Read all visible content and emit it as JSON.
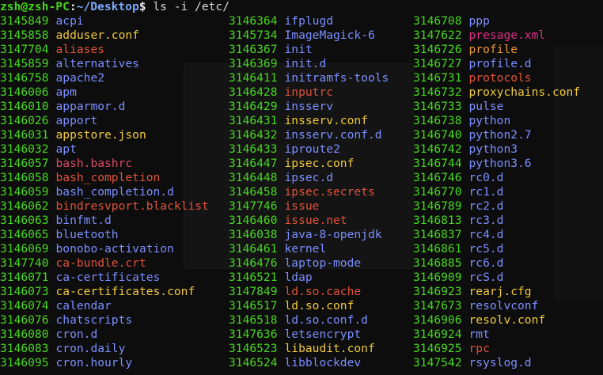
{
  "prompt": {
    "user_host": "zsh@zsh-PC",
    "separator": ":",
    "path": "~/Desktop",
    "symbol": "$",
    "command": " ls -i /etc/"
  },
  "colors": {
    "inode": "#47d820",
    "directory": "#7b8fff",
    "file": "#e8e8d0",
    "pink": "#e02f86",
    "red": "#e0533b",
    "rose": "#d94a64",
    "yellow": "#f0ca3c",
    "orange": "#e8963a",
    "background": "#0d0d0d"
  },
  "columns": [
    [
      {
        "inode": "3145849",
        "name": "acpi",
        "type": "dir"
      },
      {
        "inode": "3145858",
        "name": "adduser.conf",
        "type": "yellow"
      },
      {
        "inode": "3147704",
        "name": "aliases",
        "type": "red"
      },
      {
        "inode": "3145859",
        "name": "alternatives",
        "type": "dir"
      },
      {
        "inode": "3146758",
        "name": "apache2",
        "type": "dir"
      },
      {
        "inode": "3146006",
        "name": "apm",
        "type": "dir"
      },
      {
        "inode": "3146010",
        "name": "apparmor.d",
        "type": "dir"
      },
      {
        "inode": "3146026",
        "name": "apport",
        "type": "dir"
      },
      {
        "inode": "3146031",
        "name": "appstore.json",
        "type": "yellow"
      },
      {
        "inode": "3146032",
        "name": "apt",
        "type": "dir"
      },
      {
        "inode": "3146057",
        "name": "bash.bashrc",
        "type": "rose"
      },
      {
        "inode": "3146058",
        "name": "bash_completion",
        "type": "red"
      },
      {
        "inode": "3146059",
        "name": "bash_completion.d",
        "type": "dir"
      },
      {
        "inode": "3146062",
        "name": "bindresvport.blacklist",
        "type": "red"
      },
      {
        "inode": "3146063",
        "name": "binfmt.d",
        "type": "dir"
      },
      {
        "inode": "3146065",
        "name": "bluetooth",
        "type": "dir"
      },
      {
        "inode": "3146069",
        "name": "bonobo-activation",
        "type": "dir"
      },
      {
        "inode": "3147740",
        "name": "ca-bundle.crt",
        "type": "red"
      },
      {
        "inode": "3146071",
        "name": "ca-certificates",
        "type": "dir"
      },
      {
        "inode": "3146073",
        "name": "ca-certificates.conf",
        "type": "yellow"
      },
      {
        "inode": "3146074",
        "name": "calendar",
        "type": "dir"
      },
      {
        "inode": "3146076",
        "name": "chatscripts",
        "type": "dir"
      },
      {
        "inode": "3146080",
        "name": "cron.d",
        "type": "dir"
      },
      {
        "inode": "3146083",
        "name": "cron.daily",
        "type": "dir"
      },
      {
        "inode": "3146095",
        "name": "cron.hourly",
        "type": "dir"
      }
    ],
    [
      {
        "inode": "3146364",
        "name": "ifplugd",
        "type": "dir"
      },
      {
        "inode": "3145734",
        "name": "ImageMagick-6",
        "type": "dir"
      },
      {
        "inode": "3146367",
        "name": "init",
        "type": "dir"
      },
      {
        "inode": "3146369",
        "name": "init.d",
        "type": "dir"
      },
      {
        "inode": "3146411",
        "name": "initramfs-tools",
        "type": "dir"
      },
      {
        "inode": "3146428",
        "name": "inputrc",
        "type": "red"
      },
      {
        "inode": "3146429",
        "name": "insserv",
        "type": "dir"
      },
      {
        "inode": "3146431",
        "name": "insserv.conf",
        "type": "yellow"
      },
      {
        "inode": "3146432",
        "name": "insserv.conf.d",
        "type": "dir"
      },
      {
        "inode": "3146433",
        "name": "iproute2",
        "type": "dir"
      },
      {
        "inode": "3146447",
        "name": "ipsec.conf",
        "type": "yellow"
      },
      {
        "inode": "3146448",
        "name": "ipsec.d",
        "type": "dir"
      },
      {
        "inode": "3146458",
        "name": "ipsec.secrets",
        "type": "red"
      },
      {
        "inode": "3147746",
        "name": "issue",
        "type": "red"
      },
      {
        "inode": "3146460",
        "name": "issue.net",
        "type": "red"
      },
      {
        "inode": "3146038",
        "name": "java-8-openjdk",
        "type": "dir"
      },
      {
        "inode": "3146461",
        "name": "kernel",
        "type": "dir"
      },
      {
        "inode": "3146476",
        "name": "laptop-mode",
        "type": "dir"
      },
      {
        "inode": "3146521",
        "name": "ldap",
        "type": "dir"
      },
      {
        "inode": "3147849",
        "name": "ld.so.cache",
        "type": "red"
      },
      {
        "inode": "3146517",
        "name": "ld.so.conf",
        "type": "yellow"
      },
      {
        "inode": "3146518",
        "name": "ld.so.conf.d",
        "type": "dir"
      },
      {
        "inode": "3147636",
        "name": "letsencrypt",
        "type": "dir"
      },
      {
        "inode": "3146523",
        "name": "libaudit.conf",
        "type": "yellow"
      },
      {
        "inode": "3146524",
        "name": "libblockdev",
        "type": "dir"
      }
    ],
    [
      {
        "inode": "3146708",
        "name": "ppp",
        "type": "dir"
      },
      {
        "inode": "3147622",
        "name": "presage.xml",
        "type": "pink"
      },
      {
        "inode": "3146726",
        "name": "profile",
        "type": "orange"
      },
      {
        "inode": "3146727",
        "name": "profile.d",
        "type": "dir"
      },
      {
        "inode": "3146731",
        "name": "protocols",
        "type": "red"
      },
      {
        "inode": "3146732",
        "name": "proxychains.conf",
        "type": "yellow"
      },
      {
        "inode": "3146733",
        "name": "pulse",
        "type": "dir"
      },
      {
        "inode": "3146738",
        "name": "python",
        "type": "dir"
      },
      {
        "inode": "3146740",
        "name": "python2.7",
        "type": "dir"
      },
      {
        "inode": "3146742",
        "name": "python3",
        "type": "dir"
      },
      {
        "inode": "3146744",
        "name": "python3.6",
        "type": "dir"
      },
      {
        "inode": "3146746",
        "name": "rc0.d",
        "type": "dir"
      },
      {
        "inode": "3146770",
        "name": "rc1.d",
        "type": "dir"
      },
      {
        "inode": "3146789",
        "name": "rc2.d",
        "type": "dir"
      },
      {
        "inode": "3146813",
        "name": "rc3.d",
        "type": "dir"
      },
      {
        "inode": "3146837",
        "name": "rc4.d",
        "type": "dir"
      },
      {
        "inode": "3146861",
        "name": "rc5.d",
        "type": "dir"
      },
      {
        "inode": "3146885",
        "name": "rc6.d",
        "type": "dir"
      },
      {
        "inode": "3146909",
        "name": "rcS.d",
        "type": "dir"
      },
      {
        "inode": "3146923",
        "name": "rearj.cfg",
        "type": "yellow"
      },
      {
        "inode": "3147673",
        "name": "resolvconf",
        "type": "dir"
      },
      {
        "inode": "3146906",
        "name": "resolv.conf",
        "type": "yellow"
      },
      {
        "inode": "3146924",
        "name": "rmt",
        "type": "dir"
      },
      {
        "inode": "3146925",
        "name": "rpc",
        "type": "red"
      },
      {
        "inode": "3147542",
        "name": "rsyslog.d",
        "type": "dir"
      }
    ]
  ]
}
